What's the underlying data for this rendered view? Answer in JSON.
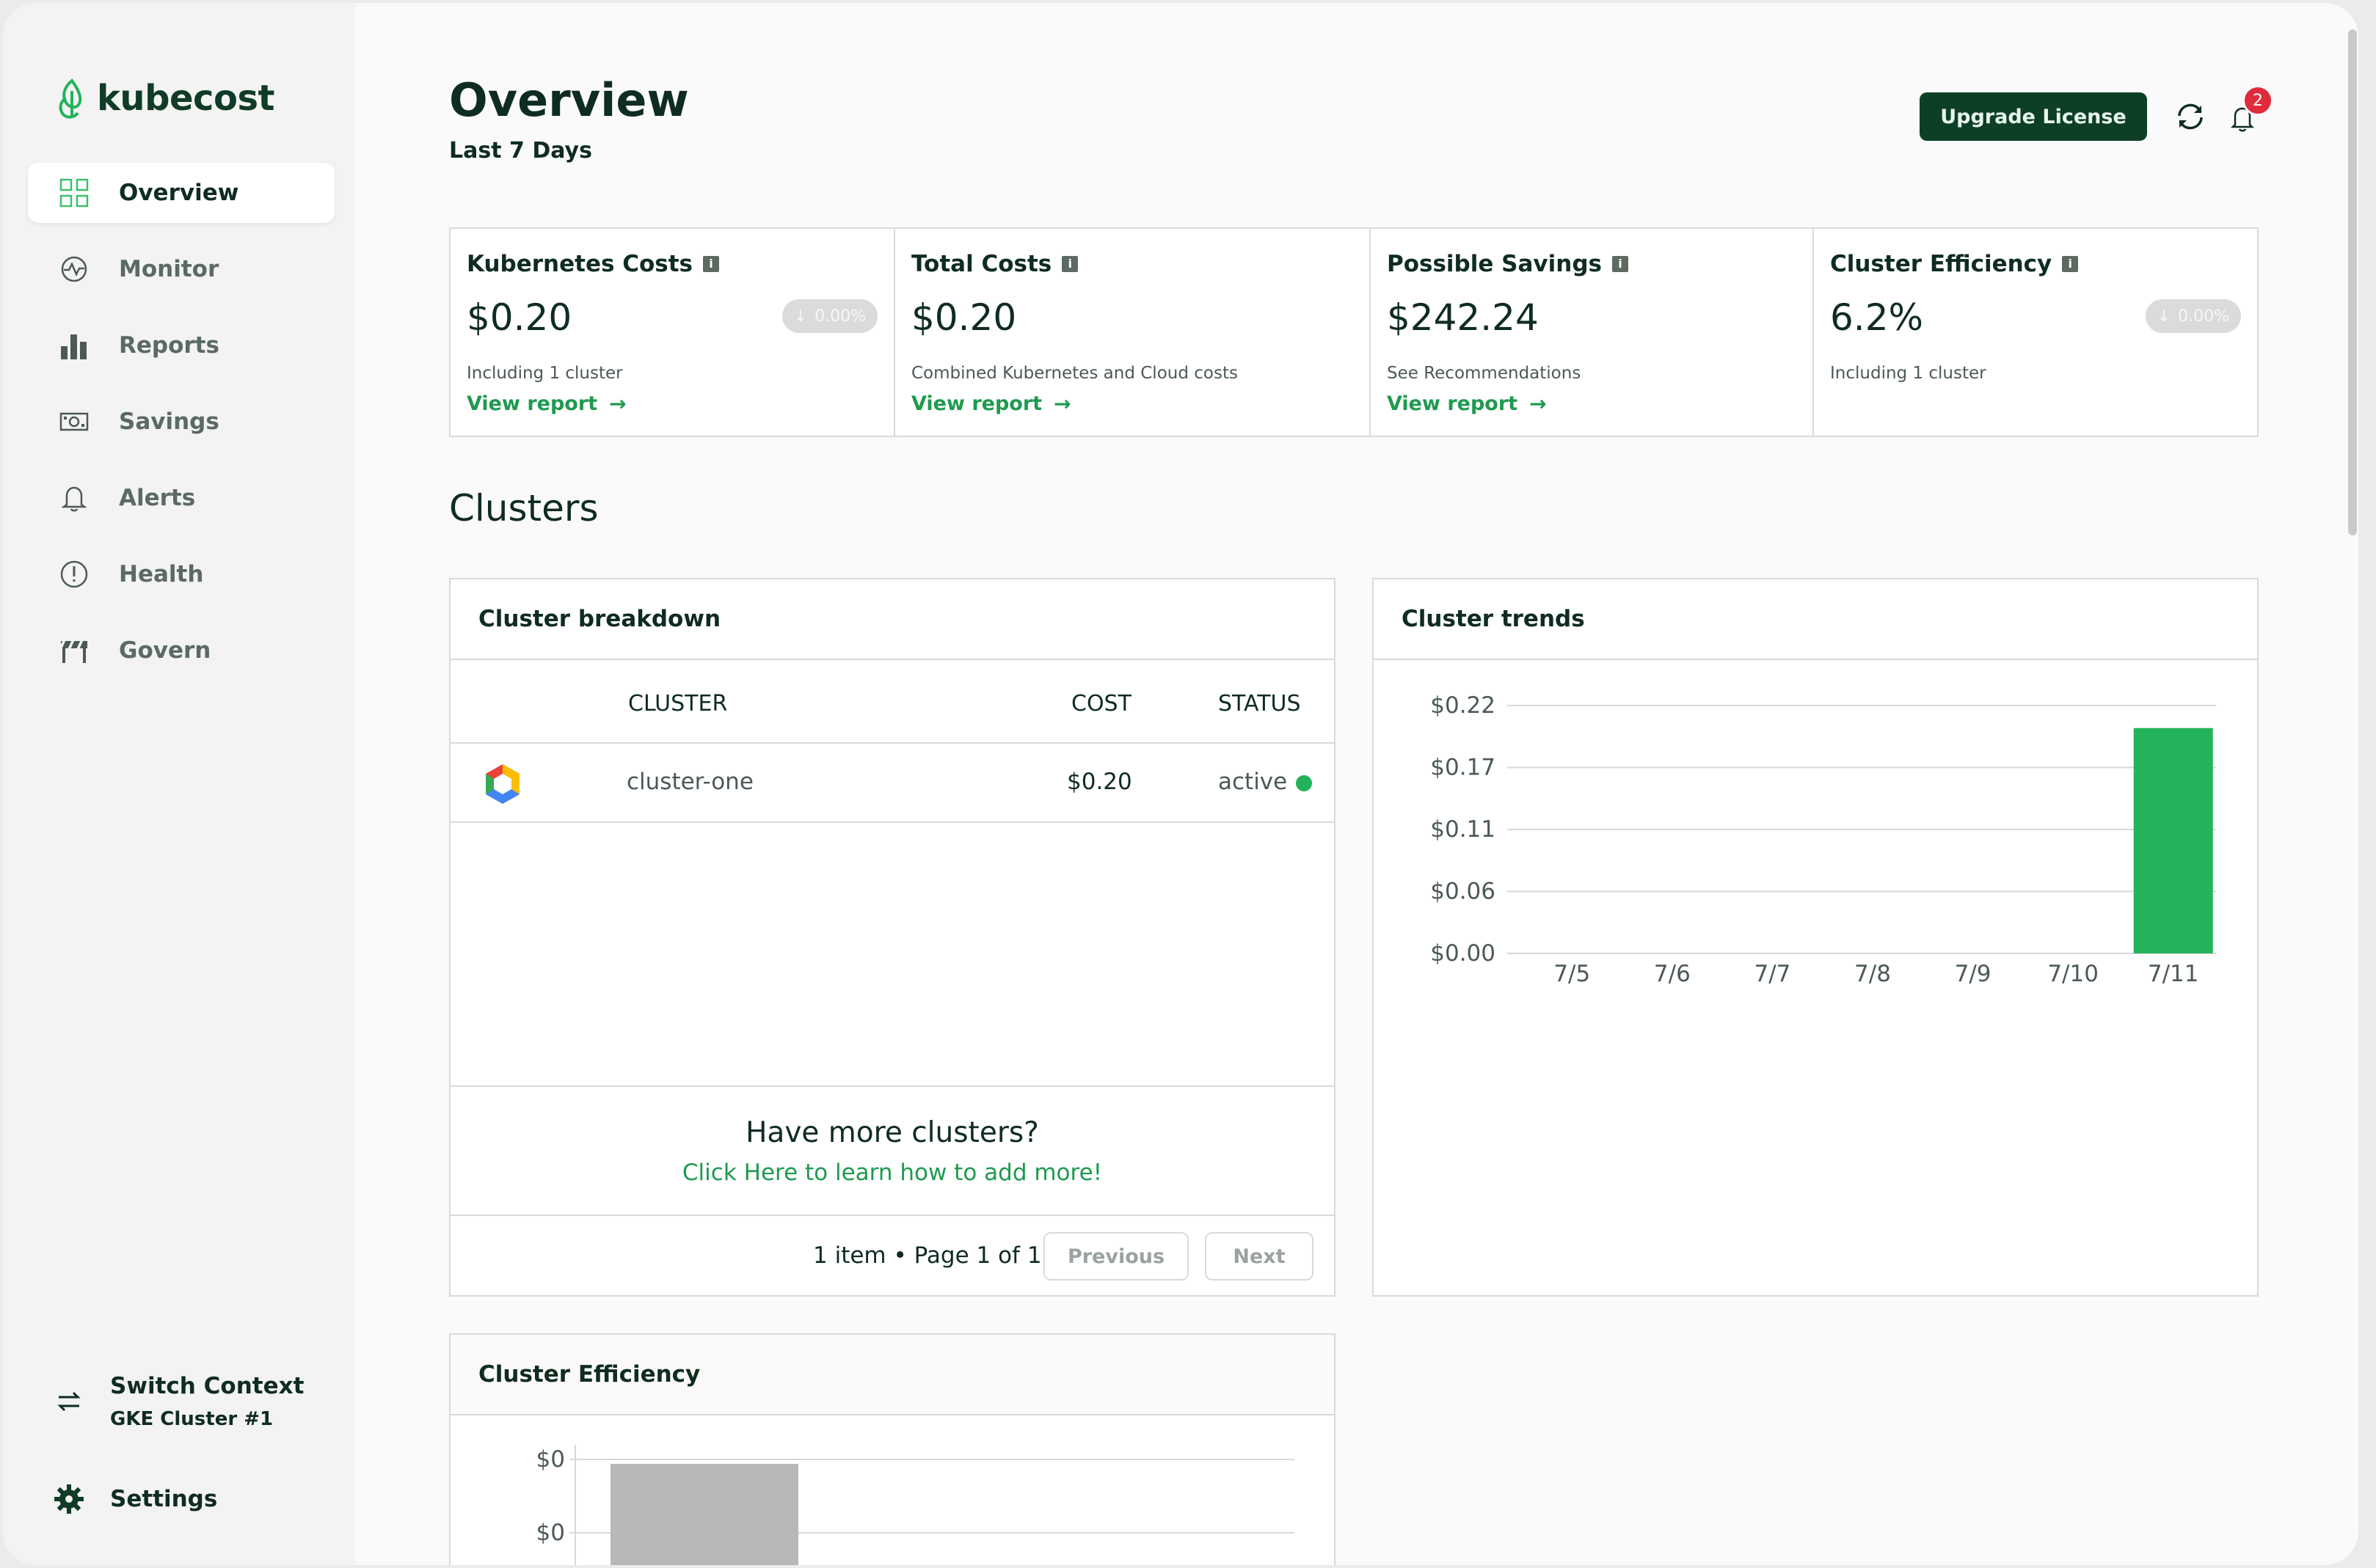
{
  "app": {
    "name": "kubecost"
  },
  "sidebar": {
    "items": [
      {
        "label": "Overview",
        "icon": "grid-icon",
        "active": true
      },
      {
        "label": "Monitor",
        "icon": "monitor-pulse-icon"
      },
      {
        "label": "Reports",
        "icon": "bar-chart-icon"
      },
      {
        "label": "Savings",
        "icon": "cash-icon"
      },
      {
        "label": "Alerts",
        "icon": "bell-icon"
      },
      {
        "label": "Health",
        "icon": "alert-circle-icon"
      },
      {
        "label": "Govern",
        "icon": "barrier-icon"
      }
    ],
    "context": {
      "title": "Switch Context",
      "value": "GKE Cluster #1"
    },
    "settings_label": "Settings"
  },
  "header": {
    "title": "Overview",
    "subtitle": "Last 7 Days",
    "upgrade_label": "Upgrade License",
    "notification_count": "2"
  },
  "kpis": [
    {
      "title": "Kubernetes Costs",
      "value": "$0.20",
      "change": "0.00%",
      "note": "Including 1 cluster",
      "link": "View report"
    },
    {
      "title": "Total Costs",
      "value": "$0.20",
      "note": "Combined Kubernetes and Cloud costs",
      "link": "View report"
    },
    {
      "title": "Possible Savings",
      "value": "$242.24",
      "note": "See Recommendations",
      "link": "View report"
    },
    {
      "title": "Cluster Efficiency",
      "value": "6.2%",
      "change": "0.00%",
      "note": "Including 1 cluster"
    }
  ],
  "clusters": {
    "section_title": "Clusters",
    "breakdown": {
      "title": "Cluster breakdown",
      "columns": [
        "CLUSTER",
        "COST",
        "STATUS"
      ],
      "rows": [
        {
          "name": "cluster-one",
          "cost": "$0.20",
          "status": "active",
          "provider_icon": "gcp-hexagon-icon"
        }
      ],
      "more_title": "Have more clusters?",
      "more_link": "Click Here to learn how to add more!",
      "pager_info": "1 item • Page 1 of 1",
      "prev_label": "Previous",
      "next_label": "Next"
    },
    "trends": {
      "title": "Cluster trends"
    },
    "efficiency": {
      "title": "Cluster Efficiency"
    }
  },
  "colors": {
    "accent": "#1f9a4f",
    "brand_dark": "#0d3f27",
    "bar_green": "#24b25a",
    "bar_gray": "#b9b8b8",
    "status_active": "#22b35a",
    "badge_red": "#e02b3c"
  },
  "chart_data": [
    {
      "type": "bar",
      "categories": [
        "7/5",
        "7/6",
        "7/7",
        "7/8",
        "7/9",
        "7/10",
        "7/11"
      ],
      "values": [
        0,
        0,
        0,
        0,
        0,
        0,
        0.2
      ],
      "yticks": [
        "$0.00",
        "$0.06",
        "$0.11",
        "$0.17",
        "$0.22"
      ],
      "ylim": [
        0,
        0.22
      ],
      "grid": true,
      "color": "#24b25a"
    },
    {
      "type": "bar",
      "categories": [
        ""
      ],
      "yticks": [
        "$0",
        "$0"
      ],
      "grid": true,
      "color": "#b9b8b8"
    }
  ]
}
